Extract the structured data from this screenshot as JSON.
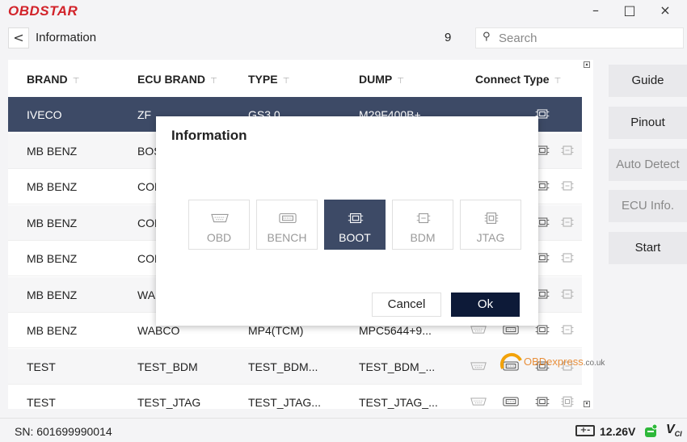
{
  "app": {
    "logo_text": "OBDSTAR",
    "minimize": "–",
    "maximize": "□",
    "close": "×"
  },
  "nav": {
    "back_glyph": "<",
    "title": "Information",
    "count": "9",
    "search_placeholder": "Search"
  },
  "table": {
    "columns": [
      "BRAND",
      "ECU BRAND",
      "TYPE",
      "DUMP",
      "Connect Type"
    ],
    "rows": [
      {
        "brand": "IVECO",
        "ecu_brand": "ZF",
        "type": "GS3.0",
        "dump": "M29F400B+",
        "connect": [
          "BOOT"
        ],
        "selected": true
      },
      {
        "brand": "MB BENZ",
        "ecu_brand": "BOSCH",
        "type": "",
        "dump": "",
        "connect": [
          "BOOT",
          "BDM"
        ]
      },
      {
        "brand": "MB BENZ",
        "ecu_brand": "CONTINENTAL",
        "type": "",
        "dump": "",
        "connect": [
          "BOOT",
          "BDM"
        ]
      },
      {
        "brand": "MB BENZ",
        "ecu_brand": "CONTINENTAL",
        "type": "",
        "dump": "",
        "connect": [
          "BOOT",
          "BDM"
        ]
      },
      {
        "brand": "MB BENZ",
        "ecu_brand": "CONTINENTAL",
        "type": "",
        "dump": "",
        "connect": [
          "BOOT",
          "BDM"
        ]
      },
      {
        "brand": "MB BENZ",
        "ecu_brand": "WABCO",
        "type": "",
        "dump": "",
        "connect": [
          "BOOT",
          "BDM"
        ]
      },
      {
        "brand": "MB BENZ",
        "ecu_brand": "WABCO",
        "type": "MP4(TCM)",
        "dump": "MPC5644+9...",
        "connect": [
          "OBD",
          "BENCH",
          "BOOT",
          "BDM"
        ]
      },
      {
        "brand": "TEST",
        "ecu_brand": "TEST_BDM",
        "type": "TEST_BDM...",
        "dump": "TEST_BDM_...",
        "connect": [
          "OBD",
          "BENCH",
          "BOOT",
          "BDM"
        ]
      },
      {
        "brand": "TEST",
        "ecu_brand": "TEST_JTAG",
        "type": "TEST_JTAG...",
        "dump": "TEST_JTAG_...",
        "connect": [
          "OBD",
          "BENCH",
          "BOOT",
          "JTAG"
        ]
      }
    ]
  },
  "sidebar": {
    "buttons": [
      "Guide",
      "Pinout",
      "Auto Detect",
      "ECU Info.",
      "Start"
    ]
  },
  "status": {
    "sn": "SN: 601699990014",
    "voltage": "12.26V",
    "battery_glyph": "+-",
    "vci_text": "V"
  },
  "modal": {
    "title": "Information",
    "options": [
      "OBD",
      "BENCH",
      "BOOT",
      "BDM",
      "JTAG"
    ],
    "selected_option": "BOOT",
    "cancel_label": "Cancel",
    "ok_label": "Ok"
  },
  "watermark": {
    "text": "OBDexpress",
    "suffix": ".co.uk"
  },
  "colors": {
    "selected_row": "#3d4a66",
    "ok_button": "#0d1a38",
    "brand_red": "#d2232a",
    "status_green": "#2eb83a"
  }
}
